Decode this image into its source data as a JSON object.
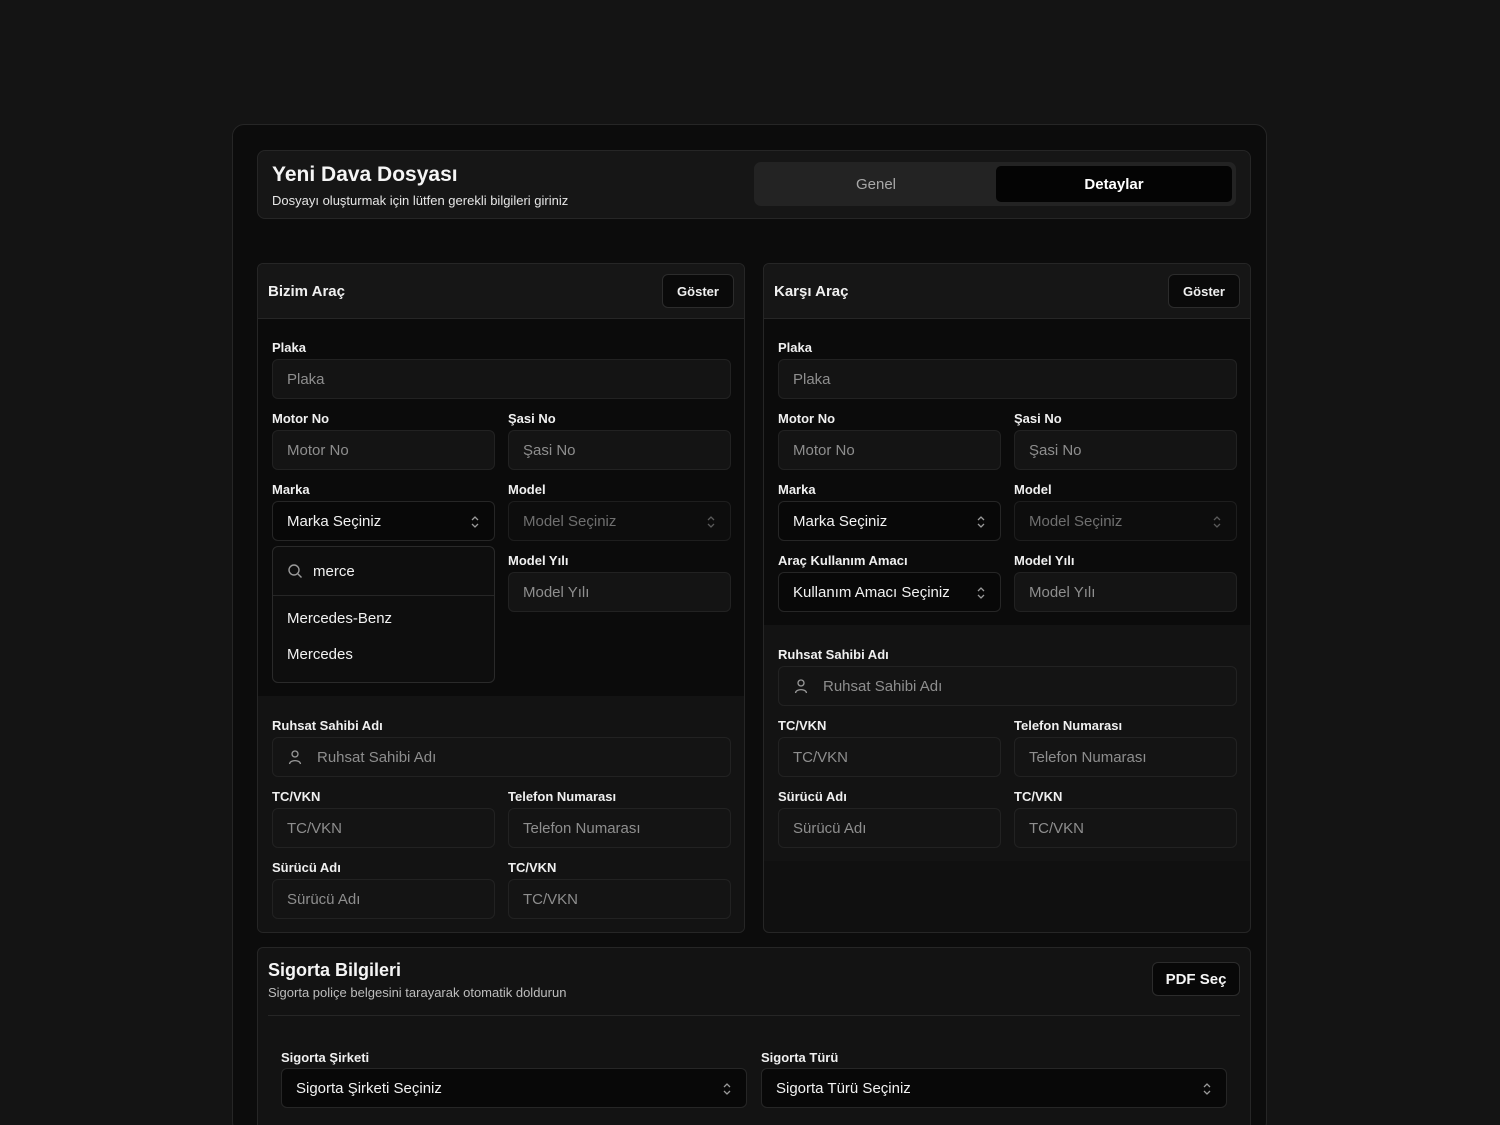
{
  "header": {
    "title": "Yeni Dava Dosyası",
    "subtitle": "Dosyayı oluşturmak için lütfen gerekli bilgileri giriniz",
    "tabs": [
      "Genel",
      "Detaylar"
    ],
    "active_tab": "Detaylar"
  },
  "our_vehicle": {
    "title": "Bizim Araç",
    "show_label": "Göster",
    "plate_label": "Plaka",
    "plate_placeholder": "Plaka",
    "engine_label": "Motor No",
    "engine_placeholder": "Motor No",
    "chassis_label": "Şasi No",
    "chassis_placeholder": "Şasi No",
    "brand_label": "Marka",
    "brand_value": "Marka Seçiniz",
    "model_label": "Model",
    "model_value": "Model Seçiniz",
    "year_label": "Model Yılı",
    "year_placeholder": "Model Yılı",
    "brand_search_value": "merce",
    "brand_options": [
      "Mercedes-Benz",
      "Mercedes"
    ],
    "owner_label": "Ruhsat Sahibi Adı",
    "owner_placeholder": "Ruhsat Sahibi Adı",
    "tc_label": "TC/VKN",
    "tc_placeholder": "TC/VKN",
    "phone_label": "Telefon Numarası",
    "phone_placeholder": "Telefon Numarası",
    "driver_label": "Sürücü Adı",
    "driver_placeholder": "Sürücü Adı",
    "driver_tc_label": "TC/VKN",
    "driver_tc_placeholder": "TC/VKN"
  },
  "other_vehicle": {
    "title": "Karşı Araç",
    "show_label": "Göster",
    "plate_label": "Plaka",
    "plate_placeholder": "Plaka",
    "engine_label": "Motor No",
    "engine_placeholder": "Motor No",
    "chassis_label": "Şasi No",
    "chassis_placeholder": "Şasi No",
    "brand_label": "Marka",
    "brand_value": "Marka Seçiniz",
    "model_label": "Model",
    "model_value": "Model Seçiniz",
    "usage_label": "Araç Kullanım Amacı",
    "usage_value": "Kullanım Amacı Seçiniz",
    "year_label": "Model Yılı",
    "year_placeholder": "Model Yılı",
    "owner_label": "Ruhsat Sahibi Adı",
    "owner_placeholder": "Ruhsat Sahibi Adı",
    "tc_label": "TC/VKN",
    "tc_placeholder": "TC/VKN",
    "phone_label": "Telefon Numarası",
    "phone_placeholder": "Telefon Numarası",
    "driver_label": "Sürücü Adı",
    "driver_placeholder": "Sürücü Adı",
    "driver_tc_label": "TC/VKN",
    "driver_tc_placeholder": "TC/VKN"
  },
  "insurance": {
    "title": "Sigorta Bilgileri",
    "subtitle": "Sigorta poliçe belgesini tarayarak otomatik doldurun",
    "pdf_button": "PDF Seç",
    "company_label": "Sigorta Şirketi",
    "company_value": "Sigorta Şirketi Seçiniz",
    "type_label": "Sigorta Türü",
    "type_value": "Sigorta Türü Seçiniz"
  },
  "colors": {
    "background": "#141414",
    "card": "#0c0c0c",
    "panel_header": "#161616",
    "active_tab": "#040404",
    "border": "#262626",
    "text": "#f2f2f2",
    "placeholder": "#8e8e8e"
  }
}
